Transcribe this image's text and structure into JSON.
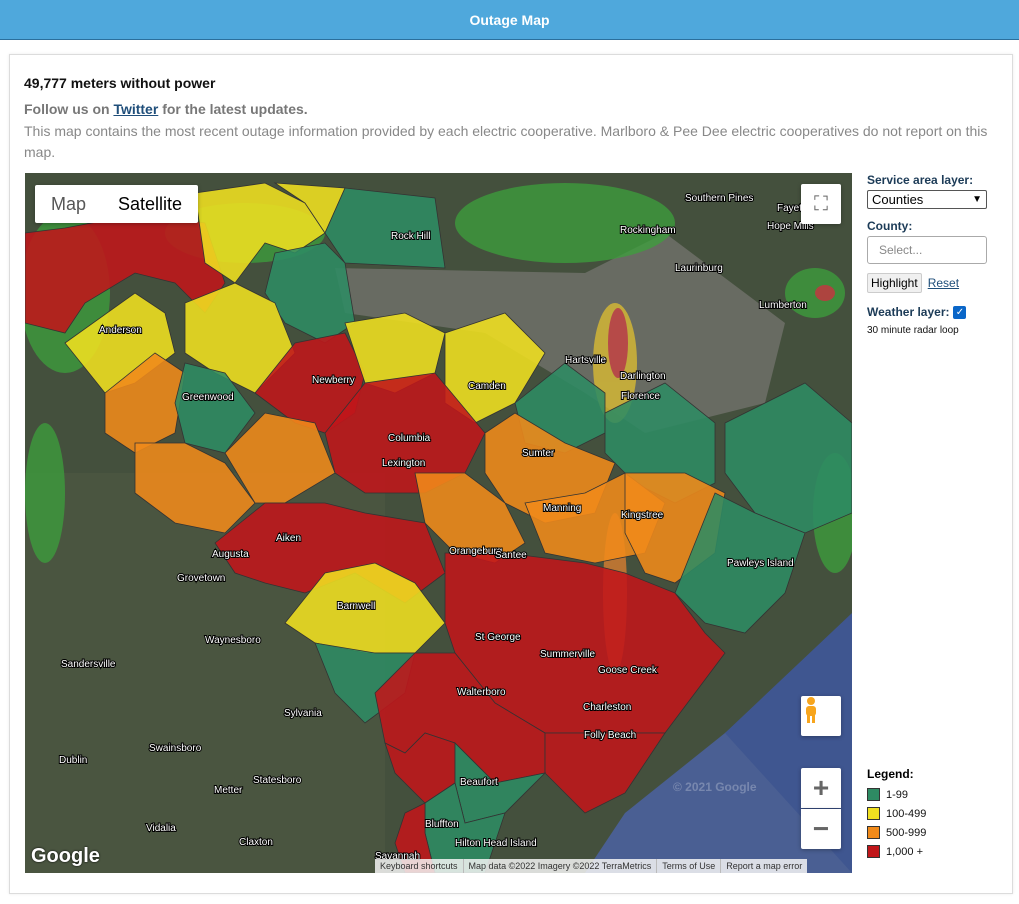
{
  "header": {
    "title": "Outage Map"
  },
  "summary": {
    "meters": "49,777 meters without power",
    "follow_prefix": "Follow us on",
    "follow_link": "Twitter",
    "follow_suffix": "for the latest updates.",
    "description": "This map contains the most recent outage information provided by each electric cooperative. Marlboro & Pee Dee electric cooperatives do not report on this map."
  },
  "map": {
    "type_map_label": "Map",
    "type_satellite_label": "Satellite",
    "attribution": [
      "Keyboard shortcuts",
      "Map data ©2022 Imagery ©2022 TerraMetrics",
      "Terms of Use",
      "Report a map error"
    ],
    "logo_text": "Google",
    "watermark": "© 2021 Google",
    "city_labels": [
      "Rock Hill",
      "Southern Pines",
      "Fayetteville",
      "Rockingham",
      "Hope Mills",
      "Laurinburg",
      "Lumberton",
      "Anderson",
      "Newberry",
      "Camden",
      "Greenwood",
      "Columbia",
      "Lexington",
      "Hartsville",
      "Darlington",
      "Florence",
      "Sumter",
      "Aiken",
      "Manning",
      "Kingstree",
      "Orangeburg",
      "Santee",
      "Augusta",
      "Grovetown",
      "Barnwell",
      "Waynesboro",
      "St George",
      "Summerville",
      "Goose Creek",
      "Charleston",
      "Folly Beach",
      "Sandersville",
      "Walterboro",
      "Sylvania",
      "Swainsboro",
      "Dublin",
      "Statesboro",
      "Metter",
      "Beaufort",
      "Vidalia",
      "Claxton",
      "Bluffton",
      "Hilton Head Island",
      "Savannah",
      "Pawleys Island"
    ],
    "colors": {
      "green": "#2e8b63",
      "yellow": "#f0e020",
      "orange": "#f08a1a",
      "red": "#c0161a"
    }
  },
  "sidebar": {
    "service_area_label": "Service area layer:",
    "service_area_value": "Counties",
    "county_label": "County:",
    "county_placeholder": "Select...",
    "highlight_label": "Highlight",
    "reset_label": "Reset",
    "weather_label": "Weather layer:",
    "weather_checked": true,
    "radar_note": "30 minute radar loop"
  },
  "legend": {
    "title": "Legend:",
    "items": [
      {
        "label": "1-99",
        "color": "#2e8b63"
      },
      {
        "label": "100-499",
        "color": "#f0e020"
      },
      {
        "label": "500-999",
        "color": "#f08a1a"
      },
      {
        "label": "1,000 +",
        "color": "#c0161a"
      }
    ]
  }
}
